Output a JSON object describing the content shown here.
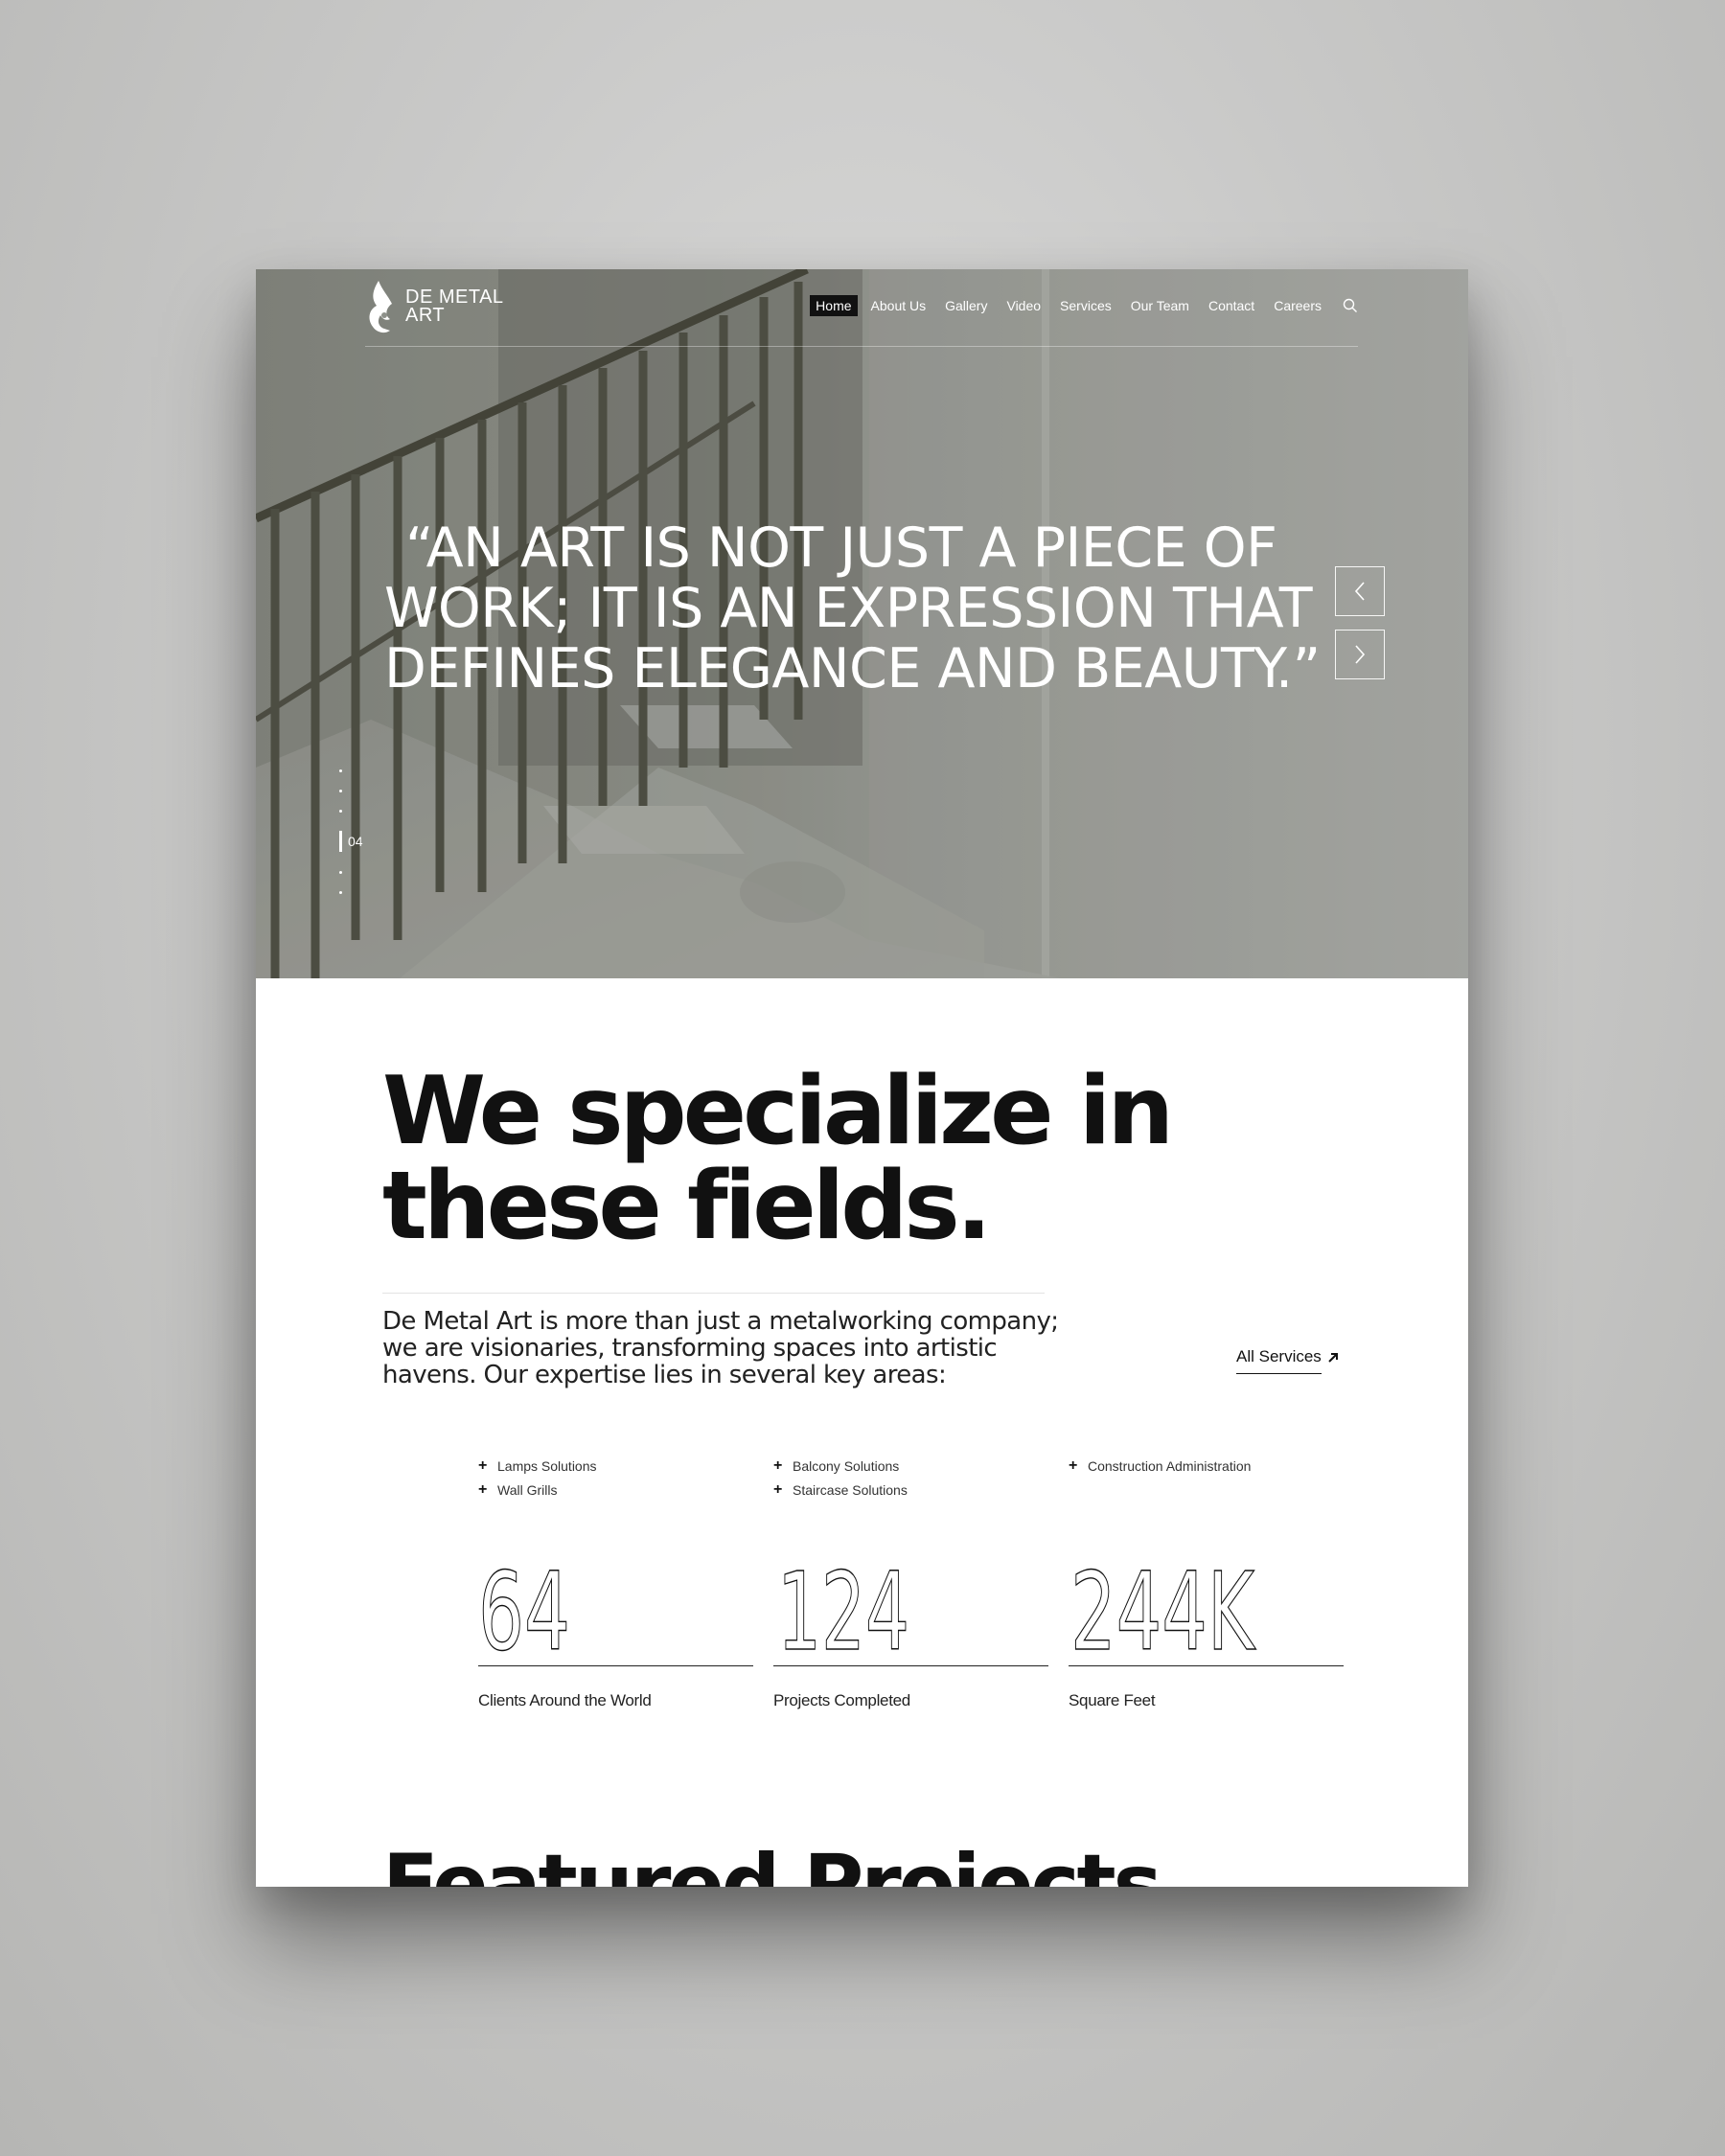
{
  "brand": {
    "line1": "DE METAL",
    "line2": "ART",
    "logo_icon": "flame-logo-icon"
  },
  "nav": {
    "items": [
      {
        "label": "Home",
        "active": true
      },
      {
        "label": "About Us"
      },
      {
        "label": "Gallery"
      },
      {
        "label": "Video"
      },
      {
        "label": "Services"
      },
      {
        "label": "Our Team"
      },
      {
        "label": "Contact"
      },
      {
        "label": "Careers"
      }
    ],
    "search_icon": "search-icon"
  },
  "hero": {
    "quote_line1": "“AN ART IS NOT JUST A PIECE OF",
    "quote_line2": "WORK; IT IS AN EXPRESSION THAT",
    "quote_line3": "DEFINES ELEGANCE AND BEAUTY.”",
    "slide_number": "04",
    "prev_icon": "chevron-left-icon",
    "next_icon": "chevron-right-icon"
  },
  "specialize": {
    "headline_line1": "We specialize in",
    "headline_line2": "these fields.",
    "intro": "De Metal Art is more than just a metalworking company; we are visionaries, transforming spaces into artistic havens. Our expertise lies in several key areas:",
    "all_services_label": "All Services",
    "services": {
      "col1": [
        "Lamps Solutions",
        "Wall Grills"
      ],
      "col2": [
        "Balcony Solutions",
        "Staircase Solutions"
      ],
      "col3": [
        "Construction Administration"
      ]
    }
  },
  "stats": [
    {
      "value": "64",
      "label": "Clients Around the World"
    },
    {
      "value": "124",
      "label": "Projects Completed"
    },
    {
      "value": "244K",
      "label": "Square Feet"
    }
  ],
  "featured": {
    "title": "Featured Projects"
  }
}
